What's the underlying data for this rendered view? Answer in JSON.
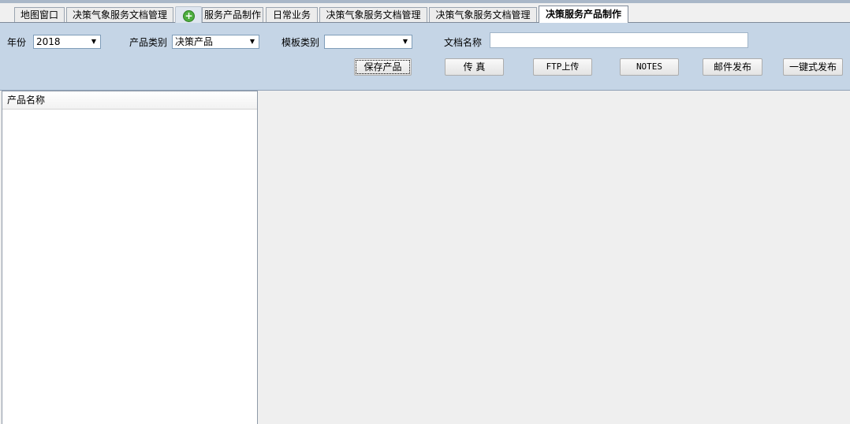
{
  "tabs": [
    {
      "label": "地图窗口"
    },
    {
      "label": "决策气象服务文档管理"
    },
    {
      "label": "服务产品制作"
    },
    {
      "label": "日常业务"
    },
    {
      "label": "决策气象服务文档管理"
    },
    {
      "label": "决策气象服务文档管理"
    },
    {
      "label": "决策服务产品制作"
    }
  ],
  "add_tab_icon": "plus-circle-icon",
  "form": {
    "year_label": "年份",
    "year_value": "2018",
    "product_type_label": "产品类别",
    "product_type_value": "决策产品",
    "template_type_label": "模板类别",
    "template_type_value": "",
    "doc_name_label": "文档名称",
    "doc_name_value": ""
  },
  "buttons": {
    "save": "保存产品",
    "fax": "传 真",
    "ftp": "FTP上传",
    "notes": "NOTES",
    "mail": "邮件发布",
    "publish_all": "一键式发布"
  },
  "list": {
    "column_header": "产品名称",
    "rows": []
  },
  "colors": {
    "panel_bg": "#c5d5e6",
    "workspace_bg": "#efefef",
    "add_icon_green": "#4eae3e"
  }
}
